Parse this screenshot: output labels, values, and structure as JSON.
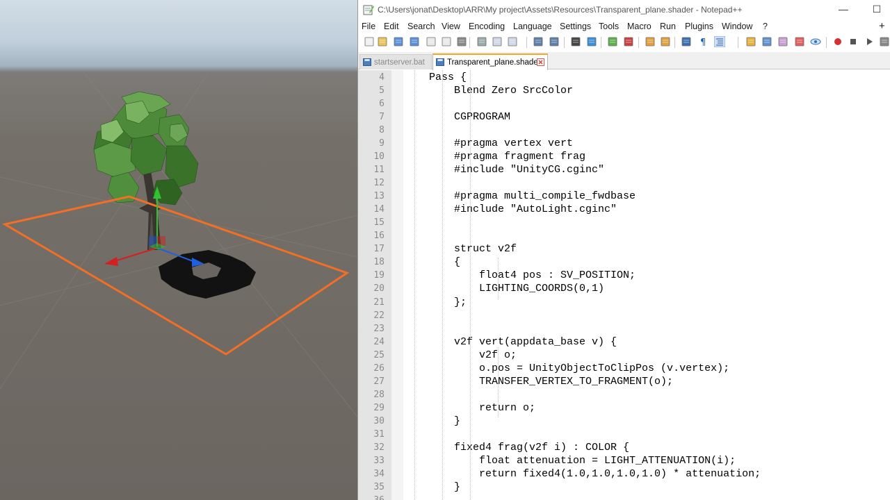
{
  "scene": {
    "description_icons": [
      "tree-model",
      "selection-outline",
      "move-gizmo",
      "shadow"
    ],
    "colors": {
      "selection_outline": "#f26f25",
      "gizmo_x": "#d42020",
      "gizmo_y": "#30c030",
      "gizmo_z": "#2060e0"
    }
  },
  "window": {
    "title": "C:\\Users\\jonat\\Desktop\\ARR\\My project\\Assets\\Resources\\Transparent_plane.shader - Notepad++",
    "minimize_label": "—",
    "maximize_label": "☐"
  },
  "menu": [
    "File",
    "Edit",
    "Search",
    "View",
    "Encoding",
    "Language",
    "Settings",
    "Tools",
    "Macro",
    "Run",
    "Plugins",
    "Window",
    "?"
  ],
  "menu_plus": "+",
  "toolbar_icons": [
    "new-file-icon",
    "open-file-icon",
    "save-icon",
    "save-all-icon",
    "close-icon",
    "close-all-icon",
    "print-icon",
    "cut-icon",
    "copy-icon",
    "paste-icon",
    "undo-icon",
    "redo-icon",
    "find-icon",
    "replace-icon",
    "zoom-in-icon",
    "zoom-out-icon",
    "sync-vertical-icon",
    "sync-horizontal-icon",
    "word-wrap-icon",
    "show-all-chars-icon",
    "indent-guide-icon",
    "udl-icon",
    "doc-map-icon",
    "function-list-icon",
    "folder-workspace-icon",
    "monitoring-icon",
    "record-macro-icon",
    "stop-macro-icon",
    "play-macro-icon",
    "run-macro-icon",
    "save-macro-icon"
  ],
  "tabs": [
    {
      "label": "startserver.bat",
      "active": false
    },
    {
      "label": "Transparent_plane.shader",
      "active": true
    }
  ],
  "code": {
    "lines": [
      {
        "num": "4",
        "text": "    Pass {"
      },
      {
        "num": "5",
        "text": "        Blend Zero SrcColor"
      },
      {
        "num": "6",
        "text": ""
      },
      {
        "num": "7",
        "text": "        CGPROGRAM"
      },
      {
        "num": "8",
        "text": ""
      },
      {
        "num": "9",
        "text": "        #pragma vertex vert"
      },
      {
        "num": "10",
        "text": "        #pragma fragment frag"
      },
      {
        "num": "11",
        "text": "        #include \"UnityCG.cginc\""
      },
      {
        "num": "12",
        "text": ""
      },
      {
        "num": "13",
        "text": "        #pragma multi_compile_fwdbase"
      },
      {
        "num": "14",
        "text": "        #include \"AutoLight.cginc\""
      },
      {
        "num": "15",
        "text": ""
      },
      {
        "num": "16",
        "text": ""
      },
      {
        "num": "17",
        "text": "        struct v2f"
      },
      {
        "num": "18",
        "text": "        {"
      },
      {
        "num": "19",
        "text": "            float4 pos : SV_POSITION;"
      },
      {
        "num": "20",
        "text": "            LIGHTING_COORDS(0,1)"
      },
      {
        "num": "21",
        "text": "        };"
      },
      {
        "num": "22",
        "text": ""
      },
      {
        "num": "23",
        "text": ""
      },
      {
        "num": "24",
        "text": "        v2f vert(appdata_base v) {"
      },
      {
        "num": "25",
        "text": "            v2f o;"
      },
      {
        "num": "26",
        "text": "            o.pos = UnityObjectToClipPos (v.vertex);"
      },
      {
        "num": "27",
        "text": "            TRANSFER_VERTEX_TO_FRAGMENT(o);"
      },
      {
        "num": "28",
        "text": ""
      },
      {
        "num": "29",
        "text": "            return o;"
      },
      {
        "num": "30",
        "text": "        }"
      },
      {
        "num": "31",
        "text": ""
      },
      {
        "num": "32",
        "text": "        fixed4 frag(v2f i) : COLOR {"
      },
      {
        "num": "33",
        "text": "            float attenuation = LIGHT_ATTENUATION(i);"
      },
      {
        "num": "34",
        "text": "            return fixed4(1.0,1.0,1.0,1.0) * attenuation;"
      },
      {
        "num": "35",
        "text": "        }"
      },
      {
        "num": "36",
        "text": ""
      }
    ]
  }
}
